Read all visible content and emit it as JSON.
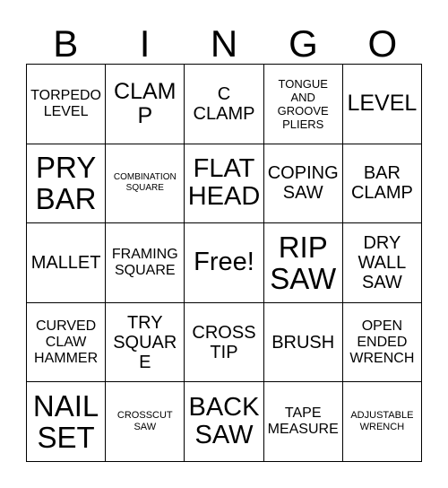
{
  "card": {
    "header_letters": [
      "B",
      "I",
      "N",
      "G",
      "O"
    ],
    "columns": 5,
    "rows": 5,
    "border_color": "#000000",
    "cell_background": "#ffffff",
    "text_color": "#000000",
    "free_space_index": 12,
    "cells": [
      {
        "text": "TORPEDO\nLEVEL",
        "size": "sm"
      },
      {
        "text": "CLAMP",
        "size": "lg"
      },
      {
        "text": "C\nCLAMP",
        "size": "md"
      },
      {
        "text": "TONGUE\nAND\nGROOVE\nPLIERS",
        "size": "xs"
      },
      {
        "text": "LEVEL",
        "size": "lg"
      },
      {
        "text": "PRY\nBAR",
        "size": "xxl"
      },
      {
        "text": "COMBINATION\nSQUARE",
        "size": "tiny"
      },
      {
        "text": "FLAT\nHEAD",
        "size": "xl"
      },
      {
        "text": "COPING\nSAW",
        "size": "md"
      },
      {
        "text": "BAR\nCLAMP",
        "size": "md"
      },
      {
        "text": "MALLET",
        "size": "md"
      },
      {
        "text": "FRAMING\nSQUARE",
        "size": "sm"
      },
      {
        "text": "Free!",
        "size": "xl"
      },
      {
        "text": "RIP\nSAW",
        "size": "xxl"
      },
      {
        "text": "DRY\nWALL\nSAW",
        "size": "md"
      },
      {
        "text": "CURVED\nCLAW\nHAMMER",
        "size": "sm"
      },
      {
        "text": "TRY\nSQUARE",
        "size": "md"
      },
      {
        "text": "CROSS\nTIP",
        "size": "md"
      },
      {
        "text": "BRUSH",
        "size": "md"
      },
      {
        "text": "OPEN\nENDED\nWRENCH",
        "size": "sm"
      },
      {
        "text": "NAIL\nSET",
        "size": "xxl"
      },
      {
        "text": "CROSSCUT\nSAW",
        "size": "xxs"
      },
      {
        "text": "BACK\nSAW",
        "size": "xl"
      },
      {
        "text": "TAPE\nMEASURE",
        "size": "sm"
      },
      {
        "text": "ADJUSTABLE\nWRENCH",
        "size": "xxs"
      }
    ]
  }
}
